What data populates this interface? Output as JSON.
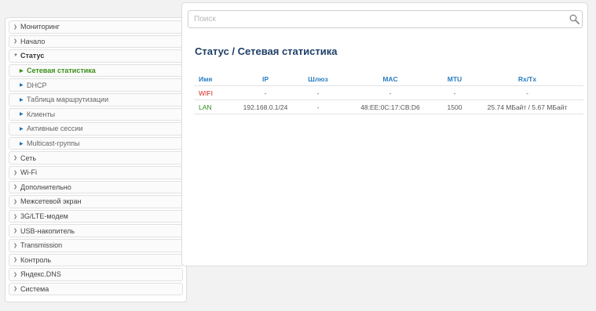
{
  "sidebar": {
    "items": [
      {
        "label": "Мониторинг",
        "type": "section",
        "icon": "chevron-right-circle-icon"
      },
      {
        "label": "Начало",
        "type": "section",
        "icon": "chevron-right-circle-icon"
      },
      {
        "label": "Статус",
        "type": "section-open",
        "icon": "chevron-down-circle-icon"
      },
      {
        "label": "Сетевая статистика",
        "type": "sub-active",
        "icon": "triangle-right-icon"
      },
      {
        "label": "DHCP",
        "type": "sub",
        "icon": "triangle-right-icon"
      },
      {
        "label": "Таблица маршрутизации",
        "type": "sub",
        "icon": "triangle-right-icon"
      },
      {
        "label": "Клиенты",
        "type": "sub",
        "icon": "triangle-right-icon"
      },
      {
        "label": "Активные сессии",
        "type": "sub",
        "icon": "triangle-right-icon"
      },
      {
        "label": "Multicast-группы",
        "type": "sub",
        "icon": "triangle-right-icon"
      },
      {
        "label": "Сеть",
        "type": "section",
        "icon": "chevron-right-circle-icon"
      },
      {
        "label": "Wi-Fi",
        "type": "section",
        "icon": "chevron-right-circle-icon"
      },
      {
        "label": "Дополнительно",
        "type": "section",
        "icon": "chevron-right-circle-icon"
      },
      {
        "label": "Межсетевой экран",
        "type": "section",
        "icon": "chevron-right-circle-icon"
      },
      {
        "label": "3G/LTE-модем",
        "type": "section",
        "icon": "chevron-right-circle-icon"
      },
      {
        "label": "USB-накопитель",
        "type": "section",
        "icon": "chevron-right-circle-icon"
      },
      {
        "label": "Transmission",
        "type": "section",
        "icon": "chevron-right-circle-icon"
      },
      {
        "label": "Контроль",
        "type": "section",
        "icon": "chevron-right-circle-icon"
      },
      {
        "label": "Яндекс.DNS",
        "type": "section",
        "icon": "chevron-right-circle-icon"
      },
      {
        "label": "Система",
        "type": "section",
        "icon": "chevron-right-circle-icon"
      }
    ]
  },
  "search": {
    "placeholder": "Поиск",
    "value": "",
    "icon": "search-icon"
  },
  "page": {
    "title": "Статус /  Сетевая статистика"
  },
  "table": {
    "headers": [
      "Имя",
      "IP",
      "Шлюз",
      "MAC",
      "MTU",
      "Rx/Tx"
    ],
    "rows": [
      {
        "name": "WIFI",
        "ip": "-",
        "gateway": "-",
        "mac": "-",
        "mtu": "-",
        "rxtx": "-",
        "status": "down"
      },
      {
        "name": "LAN",
        "ip": "192.168.0.1/24",
        "gateway": "-",
        "mac": "48:EE:0C:17:CB:D6",
        "mtu": "1500",
        "rxtx": "25.74 МБайт / 5.67 МБайт",
        "status": "up"
      }
    ]
  },
  "colors": {
    "accent": "#2a7ec2",
    "active": "#3a8f17",
    "down": "#d9261c",
    "up": "#2f8f1a",
    "title": "#1e3f66"
  }
}
